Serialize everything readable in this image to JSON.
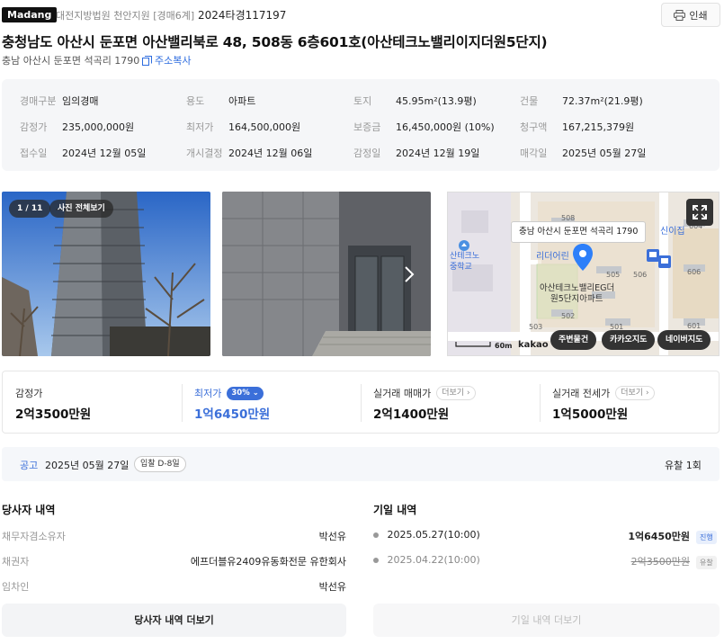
{
  "header": {
    "logo": "Madang",
    "court": "대전지방법원 천안지원 [경매6계]",
    "case_no": "2024타경117197",
    "print_label": "인쇄"
  },
  "title": "충청남도 아산시 둔포면 아산밸리북로 48, 508동 6층601호(아산테크노밸리이지더원5단지)",
  "address": "충남 아산시 둔포면 석곡리 1790",
  "copy_label": "주소복사",
  "info": [
    {
      "label": "경매구분",
      "value": "임의경매"
    },
    {
      "label": "용도",
      "value": "아파트"
    },
    {
      "label": "토지",
      "value": "45.95m²(13.9평)"
    },
    {
      "label": "건물",
      "value": "72.37m²(21.9평)"
    },
    {
      "label": "감정가",
      "value": "235,000,000원"
    },
    {
      "label": "최저가",
      "value": "164,500,000원"
    },
    {
      "label": "보증금",
      "value": "16,450,000원 (10%)"
    },
    {
      "label": "청구액",
      "value": "167,215,379원"
    },
    {
      "label": "접수일",
      "value": "2024년 12월 05일"
    },
    {
      "label": "개시결정",
      "value": "2024년 12월 06일"
    },
    {
      "label": "감정일",
      "value": "2024년 12월 19일"
    },
    {
      "label": "매각일",
      "value": "2025년 05월 27일"
    }
  ],
  "photos": {
    "counter": "1 / 11",
    "view_all": "사진 전체보기"
  },
  "map": {
    "popup": "충남 아산시 둔포면 석곡리 1790",
    "labels": [
      "508",
      "507",
      "606",
      "505",
      "506",
      "502",
      "503",
      "501",
      "601",
      "604",
      "신이집",
      "리더어린",
      "산테크노",
      "중학교",
      "아산테크노밸리EG더",
      "원5단지아파트"
    ],
    "scale": "60m",
    "brand": "kakao",
    "buttons": [
      "주변물건",
      "카카오지도",
      "네이버지도"
    ]
  },
  "prices": {
    "appraised": {
      "label": "감정가",
      "value": "2억3500만원"
    },
    "minimum": {
      "label": "최저가",
      "badge": "30%",
      "value": "1억6450만원"
    },
    "real_sale": {
      "label": "실거래 매매가",
      "more": "더보기",
      "value": "2억1400만원"
    },
    "real_jeonse": {
      "label": "실거래 전세가",
      "more": "더보기",
      "value": "1억5000만원"
    }
  },
  "notice": {
    "label": "공고",
    "date": "2025년 05월 27일",
    "dday": "입찰 D-8일",
    "result": "유찰 1회"
  },
  "parties": {
    "title": "당사자 내역",
    "rows": [
      {
        "role": "채무자겸소유자",
        "name": "박선유"
      },
      {
        "role": "채권자",
        "name": "에프더블유2409유동화전문 유한회사"
      },
      {
        "role": "임차인",
        "name": "박선유"
      }
    ],
    "more_label": "당사자 내역 더보기"
  },
  "dates": {
    "title": "기일 내역",
    "rows": [
      {
        "date": "2025.05.27(10:00)",
        "price": "1억6450만원",
        "status": "진행"
      },
      {
        "date": "2025.04.22(10:00)",
        "price": "2억3500만원",
        "status": "유찰"
      }
    ],
    "more_label": "기일 내역 더보기"
  },
  "colors": {
    "accent": "#3b6fd9",
    "marker": "#2d7ff9"
  }
}
